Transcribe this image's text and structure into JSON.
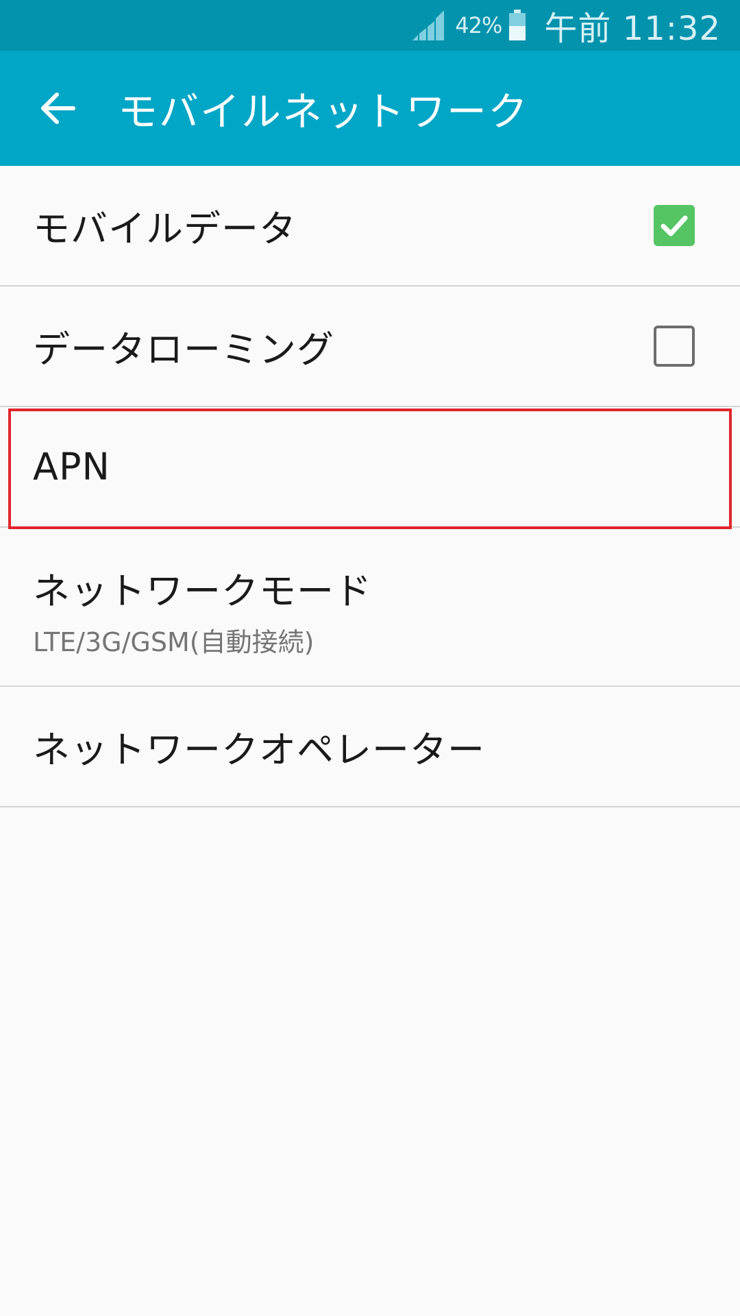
{
  "status_bar": {
    "battery_percent": "42%",
    "time": "午前 11:32"
  },
  "app_bar": {
    "title": "モバイルネットワーク"
  },
  "settings": [
    {
      "label": "モバイルデータ",
      "checked": true
    },
    {
      "label": "データローミング",
      "checked": false
    },
    {
      "label": "APN",
      "highlighted": true
    },
    {
      "label": "ネットワークモード",
      "summary": "LTE/3G/GSM(自動接続)"
    },
    {
      "label": "ネットワークオペレーター"
    }
  ],
  "colors": {
    "status_bar": "#0393ad",
    "app_bar": "#00a6c6",
    "checkbox_on": "#55c463",
    "highlight": "#e0242c"
  }
}
